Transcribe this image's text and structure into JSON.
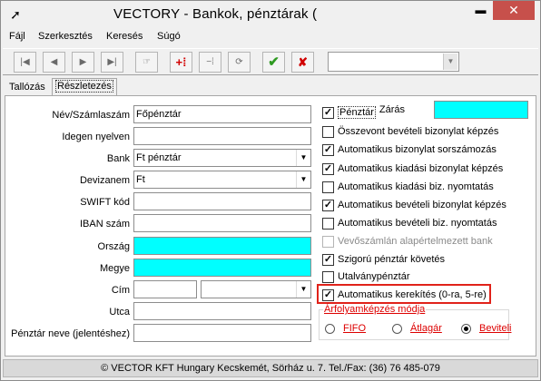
{
  "window": {
    "title": "VECTORY - Bankok, pénztárak (",
    "minimize": "▬",
    "close": "✕",
    "app_icon": "arrow-cursor-icon"
  },
  "menu": [
    "Fájl",
    "Szerkesztés",
    "Keresés",
    "Súgó"
  ],
  "toolbar": {
    "buttons": [
      "first-record-icon",
      "prev-record-icon",
      "next-record-icon",
      "last-record-icon",
      "find-icon",
      "add-record-icon",
      "delete-record-icon",
      "refresh-icon",
      "confirm-icon",
      "cancel-icon"
    ],
    "combo_value": ""
  },
  "tabs": [
    "Tallózás",
    "Részletezés"
  ],
  "form": {
    "name_label": "Név/Számlaszám",
    "name_value": "Főpénztár",
    "lang_label": "Idegen nyelven",
    "lang_value": "",
    "bank_label": "Bank",
    "bank_value": "Ft pénztár",
    "currency_label": "Devizanem",
    "currency_value": "Ft",
    "swift_label": "SWIFT kód",
    "swift_value": "",
    "iban_label": "IBAN szám",
    "iban_value": "",
    "country_label": "Ország",
    "country_value": "",
    "county_label": "Megye",
    "county_value": "",
    "address_label": "Cím",
    "address_value1": "",
    "address_value2": "",
    "street_label": "Utca",
    "street_value": "",
    "display_label": "Pénztár neve (jelentéshez)",
    "display_value": "",
    "closing_label": "Zárás",
    "closing_value": ""
  },
  "checkboxes": [
    {
      "label": "Pénztár",
      "checked": true,
      "disabled": false
    },
    {
      "label": "Összevont bevételi bizonylat képzés",
      "checked": false,
      "disabled": false
    },
    {
      "label": "Automatikus bizonylat sorszámozás",
      "checked": true,
      "disabled": false
    },
    {
      "label": "Automatikus kiadási bizonylat képzés",
      "checked": true,
      "disabled": false
    },
    {
      "label": "Automatikus kiadási biz. nyomtatás",
      "checked": false,
      "disabled": false
    },
    {
      "label": "Automatikus bevételi bizonylat képzés",
      "checked": true,
      "disabled": false
    },
    {
      "label": "Automatikus bevételi biz. nyomtatás",
      "checked": false,
      "disabled": false
    },
    {
      "label": "Vevőszámlán alapértelmezett bank",
      "checked": false,
      "disabled": true
    },
    {
      "label": "Szigorú pénztár követés",
      "checked": true,
      "disabled": false
    },
    {
      "label": "Utalványpénztár",
      "checked": false,
      "disabled": false
    },
    {
      "label": "Automatikus kerekítés (0-ra, 5-re)",
      "checked": true,
      "disabled": false
    }
  ],
  "rate_group": {
    "title": "Árfolyamképzés módja",
    "options": [
      {
        "label": "FIFO",
        "selected": false
      },
      {
        "label": "Átlagár",
        "selected": false
      },
      {
        "label": "Beviteli",
        "selected": true
      }
    ]
  },
  "status": "© VECTOR KFT    Hungary Kecskemét, Sörház u. 7.   Tel./Fax: (36) 76 485-079",
  "colors": {
    "required_field": "#00ffff",
    "highlight": "#e0221a",
    "radio_text": "#d00000"
  }
}
